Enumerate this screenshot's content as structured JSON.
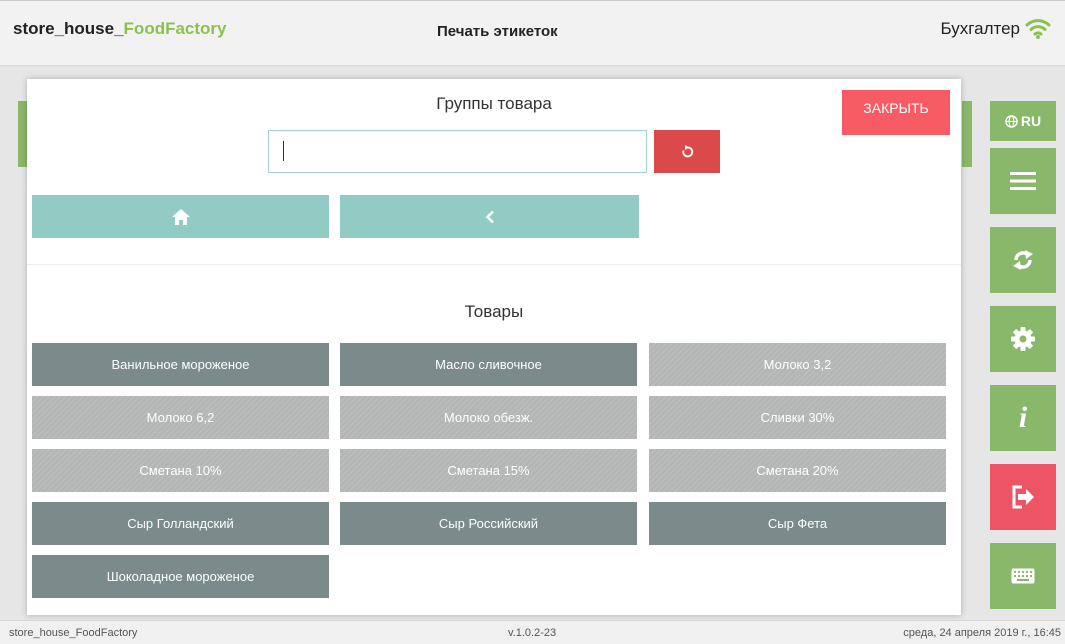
{
  "header": {
    "app_title_prefix": "store_house_",
    "app_title_brand": "FoodFactory",
    "page_title": "Печать этикеток",
    "user_role": "Бухгалтер",
    "icons": [
      "wifi-icon"
    ]
  },
  "sidebar": {
    "lang_label": "RU",
    "icons": [
      "globe-icon",
      "menu-icon",
      "sync-icon",
      "gear-icon",
      "info-icon",
      "logout-icon",
      "keyboard-icon"
    ],
    "info_glyph": "i"
  },
  "modal": {
    "groups_title": "Группы товара",
    "close_label": "ЗАКРЫТЬ",
    "search": {
      "value": "",
      "placeholder": ""
    },
    "products_title": "Товары",
    "products": [
      {
        "label": "Ванильное мороженое",
        "style": "dark"
      },
      {
        "label": "Масло сливочное",
        "style": "dark"
      },
      {
        "label": "Молоко 3,2",
        "style": "striped"
      },
      {
        "label": "Молоко 6,2",
        "style": "striped"
      },
      {
        "label": "Молоко обезж.",
        "style": "striped"
      },
      {
        "label": "Сливки 30%",
        "style": "striped"
      },
      {
        "label": "Сметана 10%",
        "style": "striped"
      },
      {
        "label": "Сметана 15%",
        "style": "striped"
      },
      {
        "label": "Сметана 20%",
        "style": "striped"
      },
      {
        "label": "Сыр Голландский",
        "style": "dark"
      },
      {
        "label": "Сыр Российский",
        "style": "dark"
      },
      {
        "label": "Сыр Фета",
        "style": "dark"
      },
      {
        "label": "Шоколадное мороженое",
        "style": "dark"
      }
    ]
  },
  "footer": {
    "app_name": "store_house_FoodFactory",
    "version": "v.1.0.2-23",
    "datetime": "среда, 24 апреля 2019 г., 16:45"
  },
  "colors": {
    "brand_green": "#8cc152",
    "sidebar_green": "#8ab86a",
    "close_red": "#f75b63",
    "reset_red": "#da4a4a",
    "logout_red": "#ed5565",
    "nav_teal": "#92cbc4",
    "product_dark": "#7b8a8a",
    "product_light": "#b4b6b6"
  }
}
